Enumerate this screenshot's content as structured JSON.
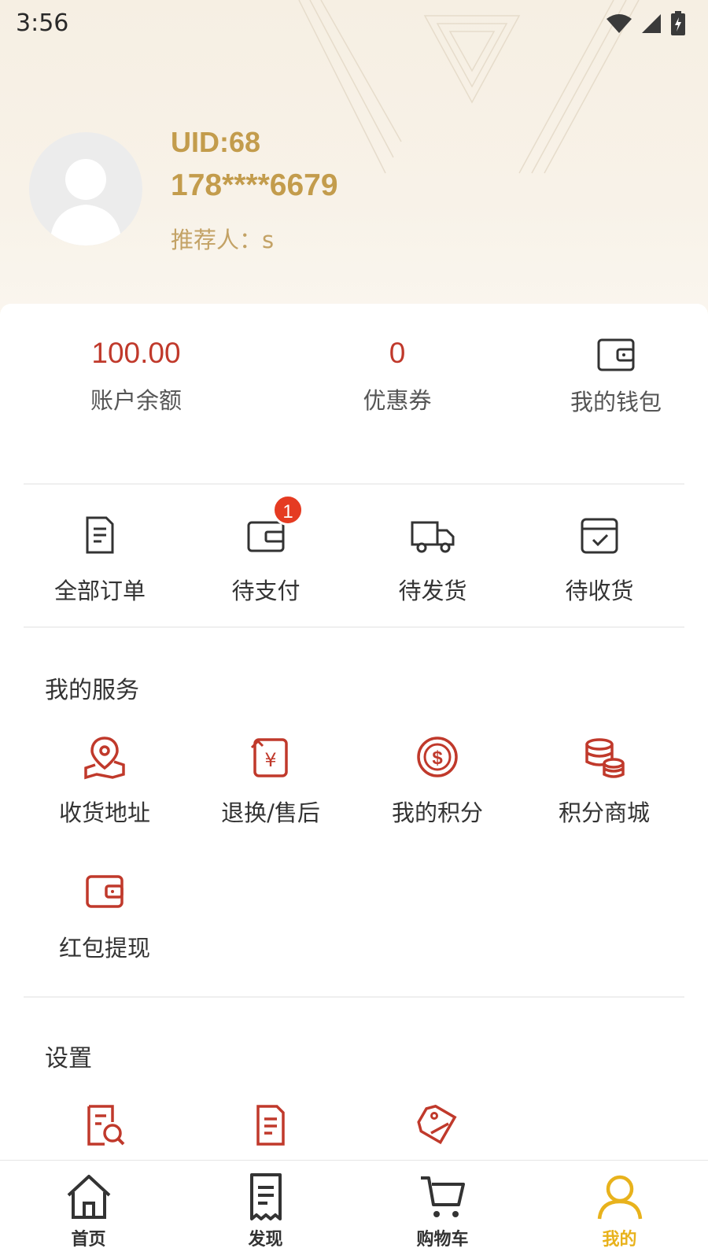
{
  "status_bar": {
    "time": "3:56"
  },
  "profile": {
    "uid": "UID:68",
    "phone": "178****6679",
    "referrer": "推荐人：s"
  },
  "stats": [
    {
      "value": "100.00",
      "label": "账户余额"
    },
    {
      "value": "0",
      "label": "优惠券"
    },
    {
      "label": "我的钱包",
      "icon": "wallet-icon"
    }
  ],
  "orders": [
    {
      "label": "全部订单",
      "icon": "order-list-icon"
    },
    {
      "label": "待支付",
      "icon": "wallet-icon",
      "badge": "1"
    },
    {
      "label": "待发货",
      "icon": "truck-icon"
    },
    {
      "label": "待收货",
      "icon": "box-check-icon"
    }
  ],
  "services": {
    "title": "我的服务",
    "items": [
      {
        "label": "收货地址",
        "icon": "map-pin-icon"
      },
      {
        "label": "退换/售后",
        "icon": "refund-icon"
      },
      {
        "label": "我的积分",
        "icon": "dollar-coin-icon"
      },
      {
        "label": "积分商城",
        "icon": "coin-stack-icon"
      },
      {
        "label": "红包提现",
        "icon": "wallet-icon"
      }
    ]
  },
  "settings": {
    "title": "设置",
    "items": [
      {
        "icon": "document-search-icon"
      },
      {
        "icon": "document-icon"
      },
      {
        "icon": "tag-icon"
      }
    ]
  },
  "tabbar": [
    {
      "label": "首页",
      "icon": "home-icon"
    },
    {
      "label": "发现",
      "icon": "receipt-icon"
    },
    {
      "label": "购物车",
      "icon": "cart-icon"
    },
    {
      "label": "我的",
      "icon": "user-icon",
      "active": true
    }
  ],
  "colors": {
    "accent_red": "#c0392b",
    "gold": "#c39c4c",
    "tab_active": "#e8b21c",
    "badge": "#e53b22"
  }
}
